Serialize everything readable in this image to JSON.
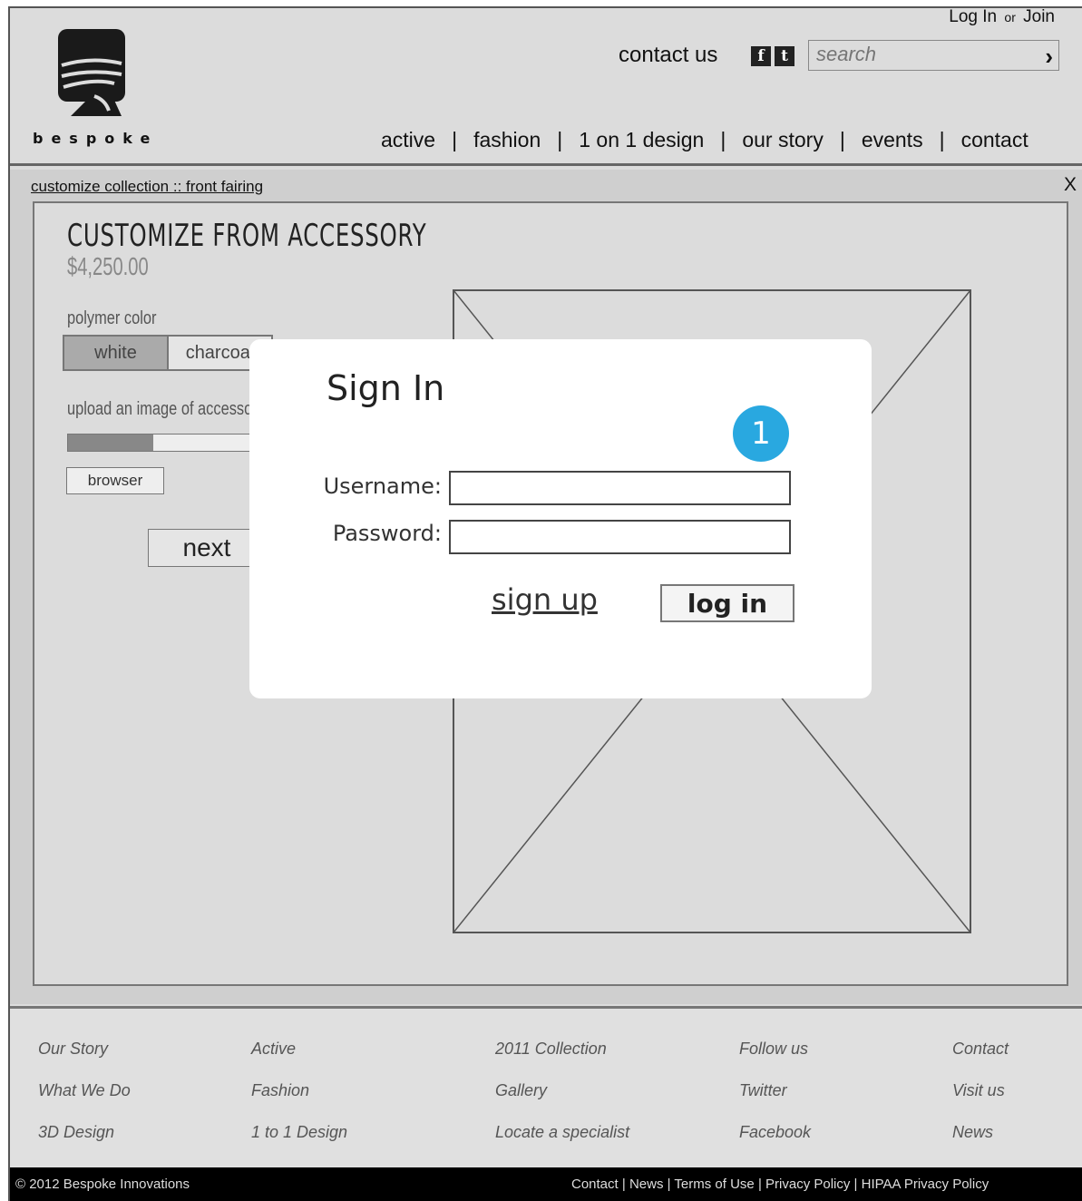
{
  "header": {
    "brand": "bespoke",
    "auth": {
      "login": "Log In",
      "or": "or",
      "join": "Join"
    },
    "contact_us": "contact us",
    "social": {
      "facebook": "f",
      "twitter": "t"
    },
    "search": {
      "placeholder": "search"
    },
    "nav": [
      "active",
      "fashion",
      "1 on 1 design",
      "our story",
      "events",
      "contact"
    ]
  },
  "breadcrumb": "customize collection :: front fairing",
  "close_label": "X",
  "customizer": {
    "title": "CUSTOMIZE FROM ACCESSORY",
    "price": "$4,250.00",
    "polymer_label": "polymer color",
    "colors": [
      "white",
      "charcoal"
    ],
    "selected_color": "white",
    "upload_label": "upload an image of accessory",
    "upload_progress": 0.43,
    "browse_label": "browser",
    "next_label": "next"
  },
  "signin_modal": {
    "title": "Sign In",
    "step_badge": "1",
    "username_label": "Username:",
    "password_label": "Password:",
    "username_value": "",
    "password_value": "",
    "signup_label": "sign up",
    "login_label": "log in",
    "badge_color": "#29a8e0"
  },
  "footer": {
    "columns": [
      [
        "Our Story",
        "What We Do",
        "3D Design"
      ],
      [
        "Active",
        "Fashion",
        "1 to 1 Design"
      ],
      [
        "2011 Collection",
        "Gallery",
        "Locate a specialist"
      ],
      [
        "Follow us",
        "Twitter",
        "Facebook"
      ],
      [
        "Contact",
        "Visit us",
        "News"
      ]
    ],
    "copyright": "© 2012 Bespoke Innovations",
    "links": [
      "Contact",
      "News",
      "Terms of Use",
      "Privacy Policy",
      "HIPAA Privacy Policy"
    ]
  }
}
